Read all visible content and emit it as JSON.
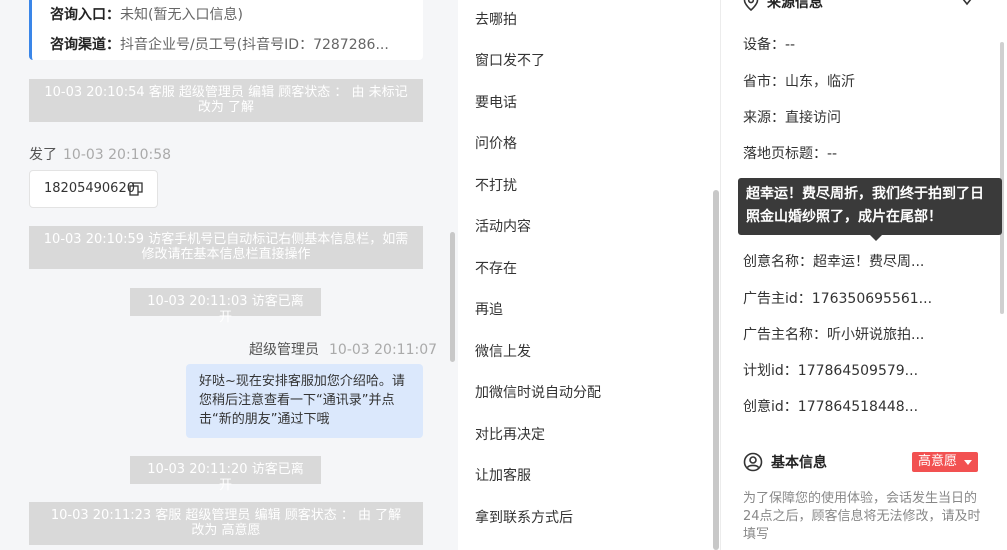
{
  "chat": {
    "card": {
      "entry_label": "咨询入口：",
      "entry_value": "未知(暂无入口信息)",
      "channel_label": "咨询渠道：",
      "channel_value": "抖音企业号/员工号(抖音号ID：7287286..."
    },
    "messages": [
      {
        "type": "system",
        "text": "10-03 20:10:54 客服 超级管理员 编辑 顾客状态 ： 由 未标记 改为 了解"
      },
      {
        "type": "visitor_header",
        "sender": "发了",
        "time": "10-03 20:10:58"
      },
      {
        "type": "visitor_phone",
        "text": "18205490620"
      },
      {
        "type": "system",
        "text": "10-03 20:10:59 访客手机号已自动标记右侧基本信息栏，如需修改请在基本信息栏直接操作"
      },
      {
        "type": "system_short",
        "text": "10-03 20:11:03 访客已离开"
      },
      {
        "type": "agent_header",
        "sender": "超级管理员",
        "time": "10-03 20:11:07"
      },
      {
        "type": "agent_text",
        "text": "好哒~现在安排客服加您介绍哈。请您稍后注意查看一下“通讯录”并点击“新的朋友”通过下哦"
      },
      {
        "type": "system_short",
        "text": "10-03 20:11:20 访客已离开"
      },
      {
        "type": "system",
        "text": "10-03 20:11:23 客服 超级管理员 编辑 顾客状态 ： 由 了解 改为 高意愿"
      }
    ]
  },
  "quick_replies": [
    "去哪拍",
    "窗口发不了",
    "要电话",
    "问价格",
    "不打扰",
    "活动内容",
    "不存在",
    "再追",
    "微信上发",
    "加微信时说自动分配",
    "对比再决定",
    "让加客服",
    "拿到联系方式后"
  ],
  "info": {
    "source_title": "来源信息",
    "fields": [
      {
        "label": "设备：",
        "value": "--"
      },
      {
        "label": "省市：",
        "value": "山东，临沂"
      },
      {
        "label": "来源：",
        "value": "直接访问"
      },
      {
        "label": "落地页标题：",
        "value": "--"
      },
      {
        "label": "创意名称：",
        "value": "超幸运！费尽周..."
      },
      {
        "label": "广告主id：",
        "value": "176350695561..."
      },
      {
        "label": "广告主名称：",
        "value": "听小妍说旅拍..."
      },
      {
        "label": "计划id：",
        "value": "177864509579..."
      },
      {
        "label": "创意id：",
        "value": "177864518448..."
      }
    ],
    "tooltip": "超幸运！费尽周折，我们终于拍到了日照金山婚纱照了，成片在尾部！",
    "basic_title": "基本信息",
    "intent_badge": "高意愿",
    "note": "为了保障您的使用体验，会话发生当日的24点之后，顾客信息将无法修改，请及时填写"
  },
  "colors": {
    "accent_blue": "#3a86e8",
    "agent_bubble": "#dbe8fc",
    "badge_red": "#f25151",
    "system_gray": "#d9d9d9"
  }
}
